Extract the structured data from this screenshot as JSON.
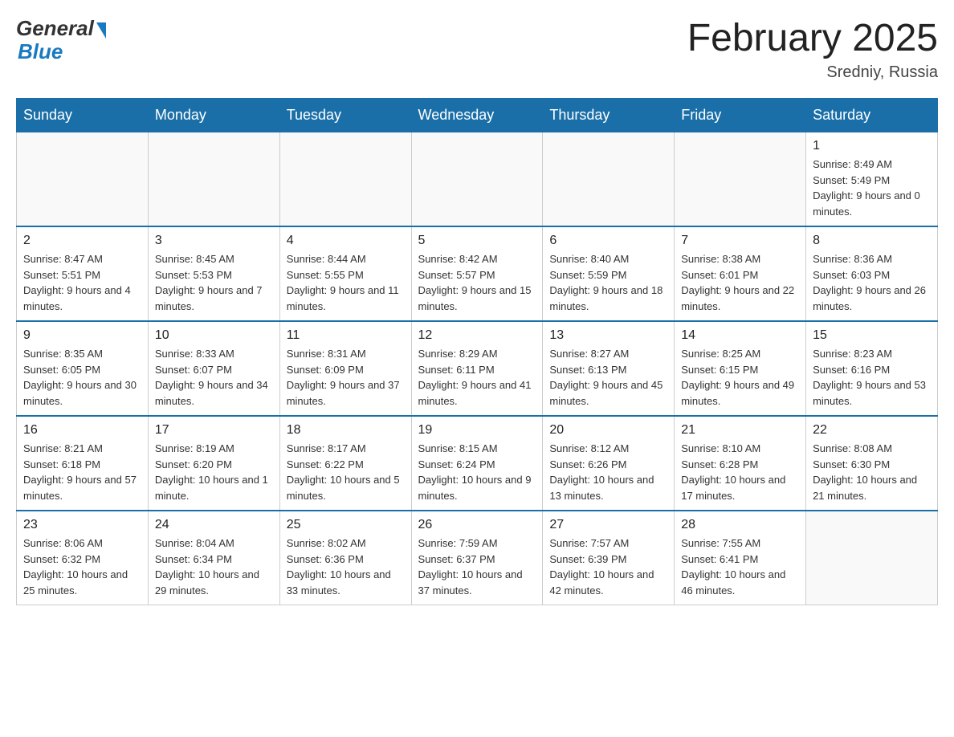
{
  "logo": {
    "general": "General",
    "blue": "Blue",
    "tagline": "Blue"
  },
  "header": {
    "title": "February 2025",
    "location": "Sredniy, Russia"
  },
  "days_of_week": [
    "Sunday",
    "Monday",
    "Tuesday",
    "Wednesday",
    "Thursday",
    "Friday",
    "Saturday"
  ],
  "weeks": [
    {
      "days": [
        {
          "date": "",
          "info": ""
        },
        {
          "date": "",
          "info": ""
        },
        {
          "date": "",
          "info": ""
        },
        {
          "date": "",
          "info": ""
        },
        {
          "date": "",
          "info": ""
        },
        {
          "date": "",
          "info": ""
        },
        {
          "date": "1",
          "info": "Sunrise: 8:49 AM\nSunset: 5:49 PM\nDaylight: 9 hours and 0 minutes."
        }
      ]
    },
    {
      "days": [
        {
          "date": "2",
          "info": "Sunrise: 8:47 AM\nSunset: 5:51 PM\nDaylight: 9 hours and 4 minutes."
        },
        {
          "date": "3",
          "info": "Sunrise: 8:45 AM\nSunset: 5:53 PM\nDaylight: 9 hours and 7 minutes."
        },
        {
          "date": "4",
          "info": "Sunrise: 8:44 AM\nSunset: 5:55 PM\nDaylight: 9 hours and 11 minutes."
        },
        {
          "date": "5",
          "info": "Sunrise: 8:42 AM\nSunset: 5:57 PM\nDaylight: 9 hours and 15 minutes."
        },
        {
          "date": "6",
          "info": "Sunrise: 8:40 AM\nSunset: 5:59 PM\nDaylight: 9 hours and 18 minutes."
        },
        {
          "date": "7",
          "info": "Sunrise: 8:38 AM\nSunset: 6:01 PM\nDaylight: 9 hours and 22 minutes."
        },
        {
          "date": "8",
          "info": "Sunrise: 8:36 AM\nSunset: 6:03 PM\nDaylight: 9 hours and 26 minutes."
        }
      ]
    },
    {
      "days": [
        {
          "date": "9",
          "info": "Sunrise: 8:35 AM\nSunset: 6:05 PM\nDaylight: 9 hours and 30 minutes."
        },
        {
          "date": "10",
          "info": "Sunrise: 8:33 AM\nSunset: 6:07 PM\nDaylight: 9 hours and 34 minutes."
        },
        {
          "date": "11",
          "info": "Sunrise: 8:31 AM\nSunset: 6:09 PM\nDaylight: 9 hours and 37 minutes."
        },
        {
          "date": "12",
          "info": "Sunrise: 8:29 AM\nSunset: 6:11 PM\nDaylight: 9 hours and 41 minutes."
        },
        {
          "date": "13",
          "info": "Sunrise: 8:27 AM\nSunset: 6:13 PM\nDaylight: 9 hours and 45 minutes."
        },
        {
          "date": "14",
          "info": "Sunrise: 8:25 AM\nSunset: 6:15 PM\nDaylight: 9 hours and 49 minutes."
        },
        {
          "date": "15",
          "info": "Sunrise: 8:23 AM\nSunset: 6:16 PM\nDaylight: 9 hours and 53 minutes."
        }
      ]
    },
    {
      "days": [
        {
          "date": "16",
          "info": "Sunrise: 8:21 AM\nSunset: 6:18 PM\nDaylight: 9 hours and 57 minutes."
        },
        {
          "date": "17",
          "info": "Sunrise: 8:19 AM\nSunset: 6:20 PM\nDaylight: 10 hours and 1 minute."
        },
        {
          "date": "18",
          "info": "Sunrise: 8:17 AM\nSunset: 6:22 PM\nDaylight: 10 hours and 5 minutes."
        },
        {
          "date": "19",
          "info": "Sunrise: 8:15 AM\nSunset: 6:24 PM\nDaylight: 10 hours and 9 minutes."
        },
        {
          "date": "20",
          "info": "Sunrise: 8:12 AM\nSunset: 6:26 PM\nDaylight: 10 hours and 13 minutes."
        },
        {
          "date": "21",
          "info": "Sunrise: 8:10 AM\nSunset: 6:28 PM\nDaylight: 10 hours and 17 minutes."
        },
        {
          "date": "22",
          "info": "Sunrise: 8:08 AM\nSunset: 6:30 PM\nDaylight: 10 hours and 21 minutes."
        }
      ]
    },
    {
      "days": [
        {
          "date": "23",
          "info": "Sunrise: 8:06 AM\nSunset: 6:32 PM\nDaylight: 10 hours and 25 minutes."
        },
        {
          "date": "24",
          "info": "Sunrise: 8:04 AM\nSunset: 6:34 PM\nDaylight: 10 hours and 29 minutes."
        },
        {
          "date": "25",
          "info": "Sunrise: 8:02 AM\nSunset: 6:36 PM\nDaylight: 10 hours and 33 minutes."
        },
        {
          "date": "26",
          "info": "Sunrise: 7:59 AM\nSunset: 6:37 PM\nDaylight: 10 hours and 37 minutes."
        },
        {
          "date": "27",
          "info": "Sunrise: 7:57 AM\nSunset: 6:39 PM\nDaylight: 10 hours and 42 minutes."
        },
        {
          "date": "28",
          "info": "Sunrise: 7:55 AM\nSunset: 6:41 PM\nDaylight: 10 hours and 46 minutes."
        },
        {
          "date": "",
          "info": ""
        }
      ]
    }
  ]
}
